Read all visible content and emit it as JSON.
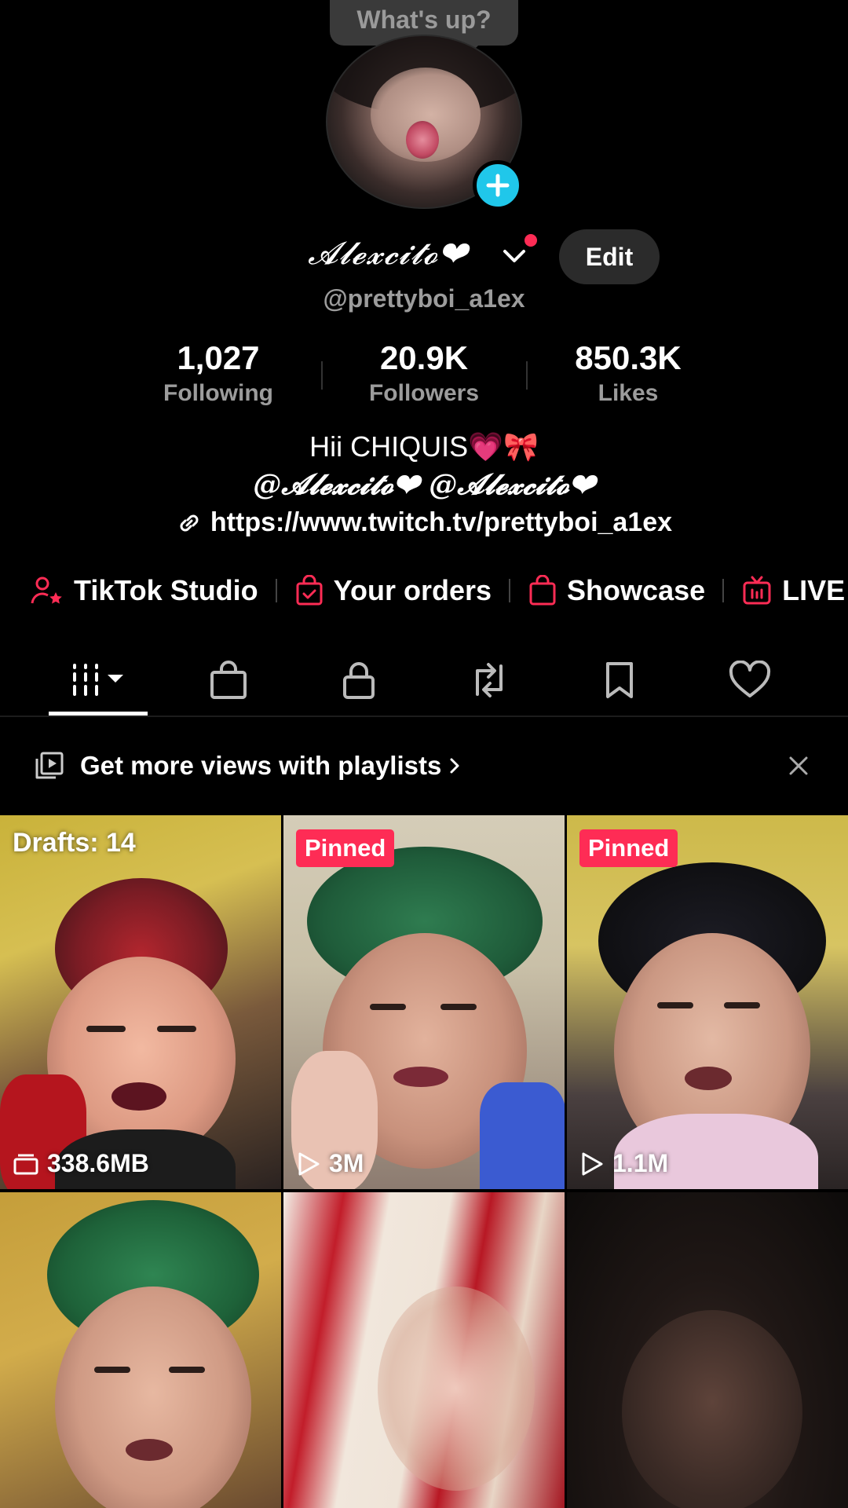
{
  "tooltip": {
    "text": "What's up?"
  },
  "profile": {
    "display_name": "𝓐𝓵𝓮𝔁𝓬𝓲𝓽𝓸❤",
    "username": "@prettyboi_a1ex",
    "edit_label": "Edit"
  },
  "stats": [
    {
      "value": "1,027",
      "label": "Following"
    },
    {
      "value": "20.9K",
      "label": "Followers"
    },
    {
      "value": "850.3K",
      "label": "Likes"
    }
  ],
  "bio": {
    "line1": "Hii CHIQUIS💗🎀",
    "line2": "@𝓐𝓵𝓮𝔁𝓬𝓲𝓽𝓸❤ @𝓐𝓵𝓮𝔁𝓬𝓲𝓽𝓸❤",
    "link": "https://www.twitch.tv/prettyboi_a1ex"
  },
  "shortcuts": [
    {
      "label": "TikTok Studio",
      "icon": "person-star-icon"
    },
    {
      "label": "Your orders",
      "icon": "bag-check-icon"
    },
    {
      "label": "Showcase",
      "icon": "shopping-bag-icon"
    },
    {
      "label": "LIVE",
      "icon": "tv-icon"
    }
  ],
  "tabs": [
    {
      "icon": "grid-videos-icon",
      "active": true
    },
    {
      "icon": "shop-bag-icon"
    },
    {
      "icon": "lock-icon"
    },
    {
      "icon": "repost-icon"
    },
    {
      "icon": "bookmark-icon"
    },
    {
      "icon": "heart-icon"
    }
  ],
  "playlist_banner": {
    "text": "Get more views with playlists"
  },
  "videos": [
    {
      "type": "drafts",
      "top_label": "Drafts: 14",
      "bottom_label": "338.6MB"
    },
    {
      "type": "pinned",
      "badge": "Pinned",
      "views": "3M"
    },
    {
      "type": "pinned",
      "badge": "Pinned",
      "views": "1.1M"
    },
    {
      "type": "video"
    },
    {
      "type": "video"
    },
    {
      "type": "video"
    }
  ],
  "colors": {
    "accent": "#fe2c55",
    "avatar_add": "#20c7ea",
    "muted_text": "#9c9c9c",
    "background": "#000000"
  }
}
